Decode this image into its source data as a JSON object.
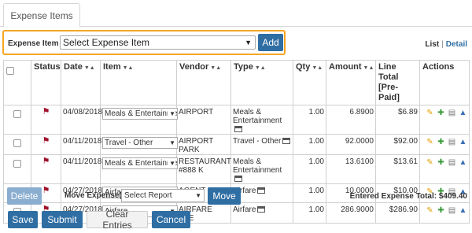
{
  "tabs": [
    {
      "label": "Expense Items"
    }
  ],
  "item_picker": {
    "label": "Expense Item :",
    "selected": "Select Expense Item",
    "add_label": "Add"
  },
  "view_links": {
    "list": "List",
    "separator": "|",
    "detail": "Detail"
  },
  "table": {
    "headers": {
      "status": "Status",
      "date": "Date",
      "item": "Item",
      "vendor": "Vendor",
      "type": "Type",
      "qty": "Qty",
      "amount": "Amount",
      "line_total_1": "Line Total",
      "line_total_2": "[Pre-Paid]",
      "actions": "Actions"
    },
    "rows": [
      {
        "date": "04/08/2018",
        "item": "Meals & Entertainment",
        "vendor": "AIRPORT",
        "type": "Meals & Entertainment",
        "qty": "1.00",
        "amount": "6.8900",
        "total": "$6.89"
      },
      {
        "date": "04/11/2018",
        "item": "Travel - Other",
        "vendor": "AIRPORT PARK",
        "type": "Travel - Other",
        "qty": "1.00",
        "amount": "92.0000",
        "total": "$92.00"
      },
      {
        "date": "04/11/2018",
        "item": "Meals & Entertainment",
        "vendor": "RESTAURANT #888 K",
        "type": "Meals & Entertainment",
        "qty": "1.00",
        "amount": "13.6100",
        "total": "$13.61"
      },
      {
        "date": "04/27/2018",
        "item": "Airfare",
        "vendor": "AGENT FEE",
        "type": "Airfare",
        "qty": "1.00",
        "amount": "10.0000",
        "total": "$10.00"
      },
      {
        "date": "04/27/2018",
        "item": "Airfare",
        "vendor": "AIRFARE FEE",
        "type": "Airfare",
        "qty": "1.00",
        "amount": "286.9000",
        "total": "$286.90"
      }
    ]
  },
  "bulk": {
    "delete_label": "Delete",
    "move_label": "Move Expense(s)",
    "report_selected": "Select Report",
    "move_button": "Move",
    "total_text": "Entered Expense Total: $409.40"
  },
  "footer": {
    "save": "Save",
    "submit": "Submit",
    "clear": "Clear Entries",
    "cancel": "Cancel"
  },
  "colors": {
    "primary": "#2f6ea3",
    "highlight": "#f5a623",
    "flag": "#a0102a"
  }
}
